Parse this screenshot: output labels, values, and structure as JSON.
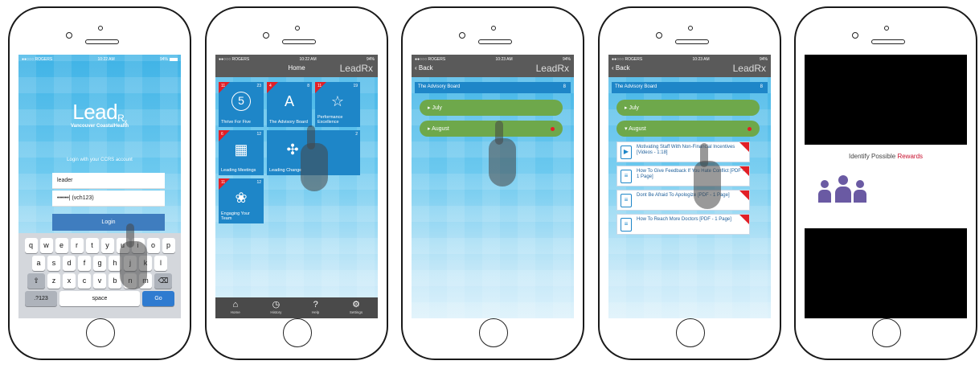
{
  "statusbar": {
    "carrier": "●●○○○ ROGERS",
    "time1": "10:22 AM",
    "time2": "10:22 AM",
    "time3": "10:23 AM",
    "time4": "10:23 AM",
    "battery": "94%"
  },
  "login": {
    "brand": "Lead",
    "brand_sub": "R",
    "brand_x": "x",
    "org": "Vancouver CoastalHealth",
    "prompt": "Login with your CCRS account",
    "username": "leader",
    "password_display": "••••••|  (vch123)",
    "login_label": "Login",
    "keyboard_rows": [
      [
        "q",
        "w",
        "e",
        "r",
        "t",
        "y",
        "u",
        "i",
        "o",
        "p"
      ],
      [
        "a",
        "s",
        "d",
        "f",
        "g",
        "h",
        "j",
        "k",
        "l"
      ],
      [
        "⇧",
        "z",
        "x",
        "c",
        "v",
        "b",
        "n",
        "m",
        "⌫"
      ],
      [
        ".?123",
        "space",
        "Go"
      ]
    ]
  },
  "home": {
    "title": "Home",
    "brand": "LeadRx",
    "tiles": [
      {
        "label": "Thrive For Five",
        "c1": "11",
        "c2": "23",
        "icon": "5"
      },
      {
        "label": "The Advisory Board",
        "c1": "4",
        "c2": "8",
        "icon": "A"
      },
      {
        "label": "Performance Excellence",
        "c1": "11",
        "c2": "19",
        "icon": "☆"
      },
      {
        "label": "Leading Meetings",
        "c1": "6",
        "c2": "12",
        "icon": "▦"
      },
      {
        "label": "Leading Change",
        "c1": "",
        "c2": "2",
        "icon": "✣"
      },
      {
        "label": "Engaging Your Team",
        "c1": "11",
        "c2": "12",
        "icon": "❀"
      }
    ],
    "tabs": [
      {
        "label": "Home",
        "icon": "⌂"
      },
      {
        "label": "History",
        "icon": "◷"
      },
      {
        "label": "Help",
        "icon": "?"
      },
      {
        "label": "Settings",
        "icon": "⚙"
      }
    ]
  },
  "advisory": {
    "back_label": "‹ Back",
    "brand": "LeadRx",
    "section": "The Advisory Board",
    "section_count": "8",
    "july": "▸ July",
    "august_collapsed": "▸ August",
    "august_expanded": "▾ August"
  },
  "docs": [
    "Motivating Staff With Non-Financial Incentives [Videos - 1:18]",
    "How To Give Feedback If You Hate Conflict [PDF - 1 Page]",
    "Dont Be Afraid To Apologize [PDF - 1 Page]",
    "How To Reach More Doctors [PDF - 1 Page]"
  ],
  "reward": {
    "heading_prefix": "Identify Possible ",
    "heading_highlight": "Rewards"
  }
}
